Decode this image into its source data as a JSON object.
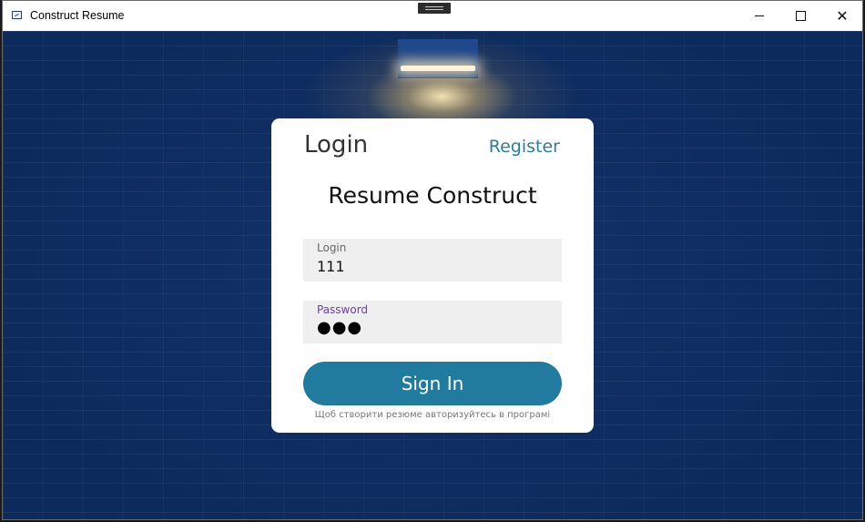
{
  "window": {
    "title": "Construct Resume",
    "icon": "app-window-icon",
    "controls": [
      "minimize-icon",
      "maximize-icon",
      "close-icon"
    ]
  },
  "card": {
    "header_login": "Login",
    "header_register": "Register",
    "app_title": "Resume Construct",
    "login_field": {
      "label": "Login",
      "value": "111"
    },
    "password_field": {
      "label": "Password",
      "value": "●●●"
    },
    "sign_in_label": "Sign In",
    "hint": "Щоб створити резюме авторизуйтесь в програмі"
  },
  "colors": {
    "accent": "#207b9e",
    "register_link": "#2a7ca0",
    "password_label": "#6a3fa6",
    "background": "#0d2a5c",
    "field_bg": "#efefef"
  }
}
